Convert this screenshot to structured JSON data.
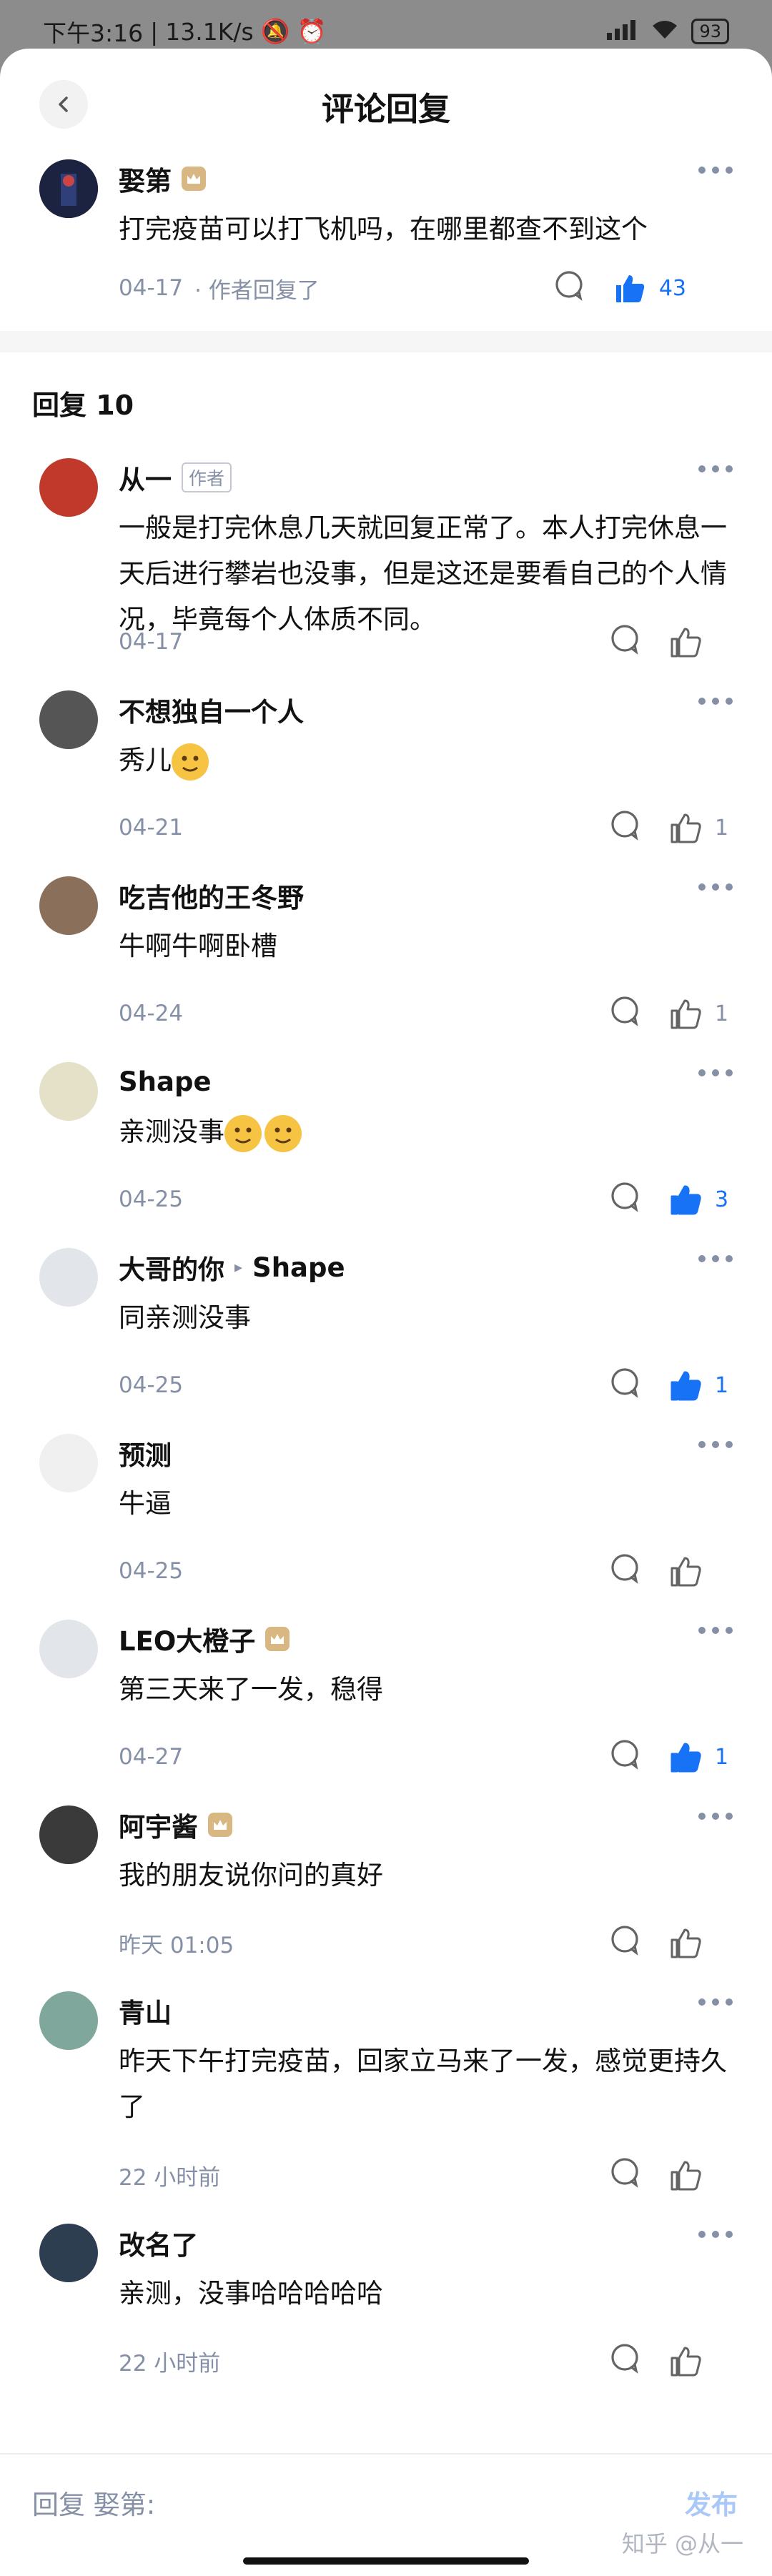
{
  "status_bar": {
    "time": "下午3:16",
    "speed": "13.1K/s",
    "battery": "93"
  },
  "header": {
    "title": "评论回复"
  },
  "main_comment": {
    "author": "娶第",
    "text": "打完疫苗可以打飞机吗，在哪里都查不到这个",
    "date": "04-17",
    "meta_suffix": "· 作者回复了",
    "likes": "43",
    "liked": true,
    "has_badge": true
  },
  "replies_section": {
    "label": "回复 10"
  },
  "replies": [
    {
      "author": "从一",
      "tag": "作者",
      "text": "一般是打完休息几天就回复正常了。本人打完休息一天后进行攀岩也没事，但是这还是要看自己的个人情况，毕竟每个人体质不同。",
      "date": "04-17",
      "likes": "",
      "liked": false,
      "has_badge": false,
      "avatar_color": "#c0392b"
    },
    {
      "author": "不想独自一个人",
      "text": "秀儿",
      "emoji_count": 1,
      "date": "04-21",
      "likes": "1",
      "liked": false,
      "has_badge": false,
      "avatar_color": "#555"
    },
    {
      "author": "吃吉他的王冬野",
      "text": "牛啊牛啊卧槽",
      "date": "04-24",
      "likes": "1",
      "liked": false,
      "has_badge": false,
      "avatar_color": "#8a6f5a"
    },
    {
      "author": "Shape",
      "text": "亲测没事",
      "emoji_count": 2,
      "date": "04-25",
      "likes": "3",
      "liked": true,
      "has_badge": false,
      "avatar_color": "#e5e0c8"
    },
    {
      "author": "大哥的你",
      "reply_to": "Shape",
      "text": "同亲测没事",
      "date": "04-25",
      "likes": "1",
      "liked": true,
      "has_badge": false,
      "avatar_color": "#e2e5ea"
    },
    {
      "author": "预测",
      "text": "牛逼",
      "date": "04-25",
      "likes": "",
      "liked": false,
      "has_badge": false,
      "avatar_color": "#f0f0f0"
    },
    {
      "author": "LEO大橙子",
      "text": "第三天来了一发，稳得",
      "date": "04-27",
      "likes": "1",
      "liked": true,
      "has_badge": true,
      "avatar_color": "#e2e5ea"
    },
    {
      "author": "阿宇酱",
      "text": "我的朋友说你问的真好",
      "date": "昨天 01:05",
      "likes": "",
      "liked": false,
      "has_badge": true,
      "avatar_color": "#3a3a3a"
    },
    {
      "author": "青山",
      "text": "昨天下午打完疫苗，回家立马来了一发，感觉更持久了",
      "date": "22 小时前",
      "likes": "",
      "liked": false,
      "has_badge": false,
      "avatar_color": "#7fa79c"
    },
    {
      "author": "改名了",
      "text": "亲测，没事哈哈哈哈哈",
      "date": "22 小时前",
      "likes": "",
      "liked": false,
      "has_badge": false,
      "avatar_color": "#2c3e50"
    }
  ],
  "bottom_bar": {
    "placeholder": "回复 娶第:",
    "publish": "发布",
    "watermark": "知乎 @从一"
  },
  "colors": {
    "accent": "#1772f6",
    "meta": "#8590a6",
    "badge": "#d9b783"
  }
}
